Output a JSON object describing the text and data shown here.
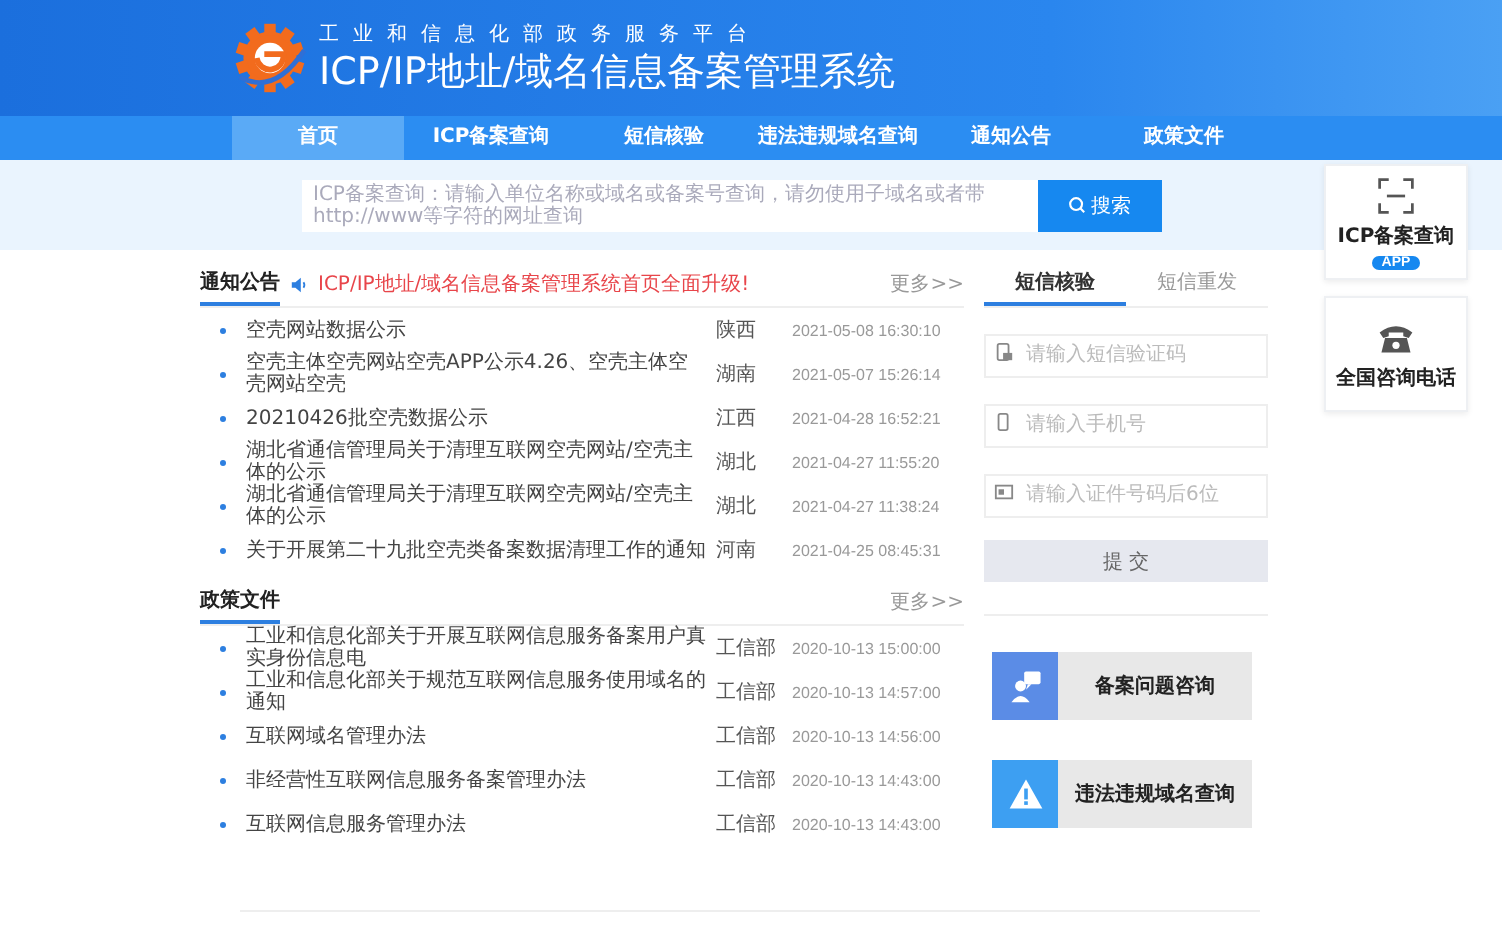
{
  "header": {
    "subtitle": "工业和信息化部政务服务平台",
    "title": "ICP/IP地址/域名信息备案管理系统"
  },
  "nav": [
    {
      "label": "首页",
      "selected": true
    },
    {
      "label": "ICP备案查询",
      "selected": false
    },
    {
      "label": "短信核验",
      "selected": false
    },
    {
      "label": "违法违规域名查询",
      "selected": false
    },
    {
      "label": "通知公告",
      "selected": false
    },
    {
      "label": "政策文件",
      "selected": false
    }
  ],
  "search": {
    "placeholder": "ICP备案查询：请输入单位名称或域名或备案号查询，请勿使用子域名或者带http://www等字符的网址查询",
    "button": "搜索"
  },
  "notices": {
    "title": "通知公告",
    "ticker": "ICP/IP地址/域名信息备案管理系统首页全面升级!",
    "more": "更多>>",
    "items": [
      {
        "title": "空壳网站数据公示",
        "region": "陕西",
        "date": "2021-05-08 16:30:10"
      },
      {
        "title": "空壳主体空壳网站空壳APP公示4.26、空壳主体空壳网站空壳",
        "region": "湖南",
        "date": "2021-05-07 15:26:14"
      },
      {
        "title": "20210426批空壳数据公示",
        "region": "江西",
        "date": "2021-04-28 16:52:21"
      },
      {
        "title": "湖北省通信管理局关于清理互联网空壳网站/空壳主体的公示",
        "region": "湖北",
        "date": "2021-04-27 11:55:20"
      },
      {
        "title": "湖北省通信管理局关于清理互联网空壳网站/空壳主体的公示",
        "region": "湖北",
        "date": "2021-04-27 11:38:24"
      },
      {
        "title": "关于开展第二十九批空壳类备案数据清理工作的通知",
        "region": "河南",
        "date": "2021-04-25 08:45:31"
      }
    ]
  },
  "policies": {
    "title": "政策文件",
    "more": "更多>>",
    "items": [
      {
        "title": "工业和信息化部关于开展互联网信息服务备案用户真实身份信息电",
        "source": "工信部",
        "date": "2020-10-13 15:00:00"
      },
      {
        "title": "工业和信息化部关于规范互联网信息服务使用域名的通知",
        "source": "工信部",
        "date": "2020-10-13 14:57:00"
      },
      {
        "title": "互联网域名管理办法",
        "source": "工信部",
        "date": "2020-10-13 14:56:00"
      },
      {
        "title": "非经营性互联网信息服务备案管理办法",
        "source": "工信部",
        "date": "2020-10-13 14:43:00"
      },
      {
        "title": "互联网信息服务管理办法",
        "source": "工信部",
        "date": "2020-10-13 14:43:00"
      }
    ]
  },
  "sms": {
    "tabs": [
      {
        "label": "短信核验",
        "selected": true
      },
      {
        "label": "短信重发",
        "selected": false
      }
    ],
    "fields": [
      {
        "kind": "code",
        "placeholder": "请输入短信验证码"
      },
      {
        "kind": "mobile",
        "placeholder": "请输入手机号"
      },
      {
        "kind": "idcard",
        "placeholder": "请输入证件号码后6位"
      }
    ],
    "submit": {
      "label": "提 交",
      "disabled": true
    }
  },
  "quick_links": [
    {
      "kind": "consult",
      "label": "备案问题咨询",
      "color": "#5b8ce6"
    },
    {
      "kind": "warning",
      "label": "违法违规域名查询",
      "color": "#3d9ff2"
    }
  ],
  "float_panel": [
    {
      "kind": "scan",
      "label": "ICP备案查询",
      "badge": "APP"
    },
    {
      "kind": "phone",
      "label": "全国咨询电话"
    }
  ]
}
